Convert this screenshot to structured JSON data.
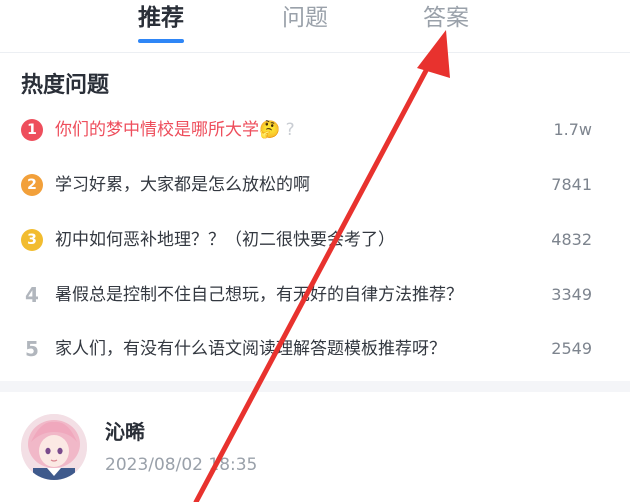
{
  "tabs": [
    {
      "label": "推荐",
      "active": true
    },
    {
      "label": "问题",
      "active": false
    },
    {
      "label": "答案",
      "active": false
    }
  ],
  "hot": {
    "title": "热度问题",
    "items": [
      {
        "rank": "1",
        "text": "你们的梦中情校是哪所大学🤔",
        "extra": "?",
        "count": "1.7w",
        "color": "#ee4e5c"
      },
      {
        "rank": "2",
        "text": "学习好累，大家都是怎么放松的啊",
        "count": "7841",
        "color": "#f2a03a"
      },
      {
        "rank": "3",
        "text": "初中如何恶补地理？？（初二很快要会考了）",
        "count": "4832",
        "color": "#f2bc2f"
      },
      {
        "rank": "4",
        "text": "暑假总是控制不住自己想玩，有无好的自律方法推荐？",
        "count": "3349"
      },
      {
        "rank": "5",
        "text": "家人们，有没有什么语文阅读理解答题模板推荐呀？",
        "count": "2549"
      }
    ]
  },
  "post": {
    "username": "沁晞",
    "time": "2023/08/02 18:35",
    "avatar_icon": "anime-girl-avatar"
  },
  "annotation": {
    "arrow_color": "#e8322e"
  }
}
